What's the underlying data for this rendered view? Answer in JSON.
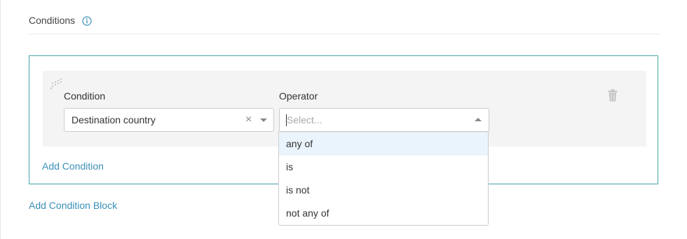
{
  "conditions_section": {
    "title": "Conditions",
    "info_icon": "info-circle-icon"
  },
  "block": {
    "border_color": "#4aa3a8",
    "row": {
      "drag_icon": "drag-handle-icon",
      "condition": {
        "label": "Condition",
        "selected_value": "Destination country",
        "clear_icon": "×"
      },
      "operator": {
        "label": "Operator",
        "placeholder": "Select...",
        "is_open": true,
        "options": [
          "any of",
          "is",
          "is not",
          "not any of"
        ],
        "highlighted_option": "any of"
      },
      "delete_icon": "trash-icon"
    },
    "add_condition_label": "Add Condition"
  },
  "add_condition_block_label": "Add Condition Block",
  "colors": {
    "link": "#3a8fb7",
    "highlight": "#eaf4fc",
    "row_background": "#f4f4f4"
  }
}
